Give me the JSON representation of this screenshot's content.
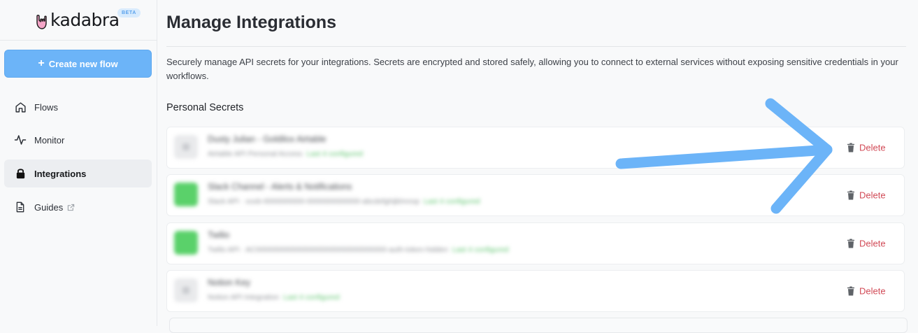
{
  "brand": {
    "name": "kadabra",
    "badge": "BETA"
  },
  "sidebar": {
    "create_button": "Create new flow",
    "items": [
      {
        "label": "Flows",
        "icon": "home-icon",
        "active": false
      },
      {
        "label": "Monitor",
        "icon": "activity-icon",
        "active": false
      },
      {
        "label": "Integrations",
        "icon": "lock-icon",
        "active": true
      },
      {
        "label": "Guides",
        "icon": "document-icon",
        "active": false,
        "external": true
      }
    ]
  },
  "main": {
    "title": "Manage Integrations",
    "description": "Securely manage API secrets for your integrations. Secrets are encrypted and stored safely, allowing you to connect to external services without exposing sensitive credentials in your workflows.",
    "section_title": "Personal Secrets",
    "secrets": [
      {
        "name": "Dusty Julian - Goldilox Airtable",
        "meta": "Airtable API Personal Access",
        "status": "Last 4 configured",
        "icon": "gray",
        "delete_label": "Delete"
      },
      {
        "name": "Slack Channel - Alerts & Notifications",
        "meta": "Slack API · xoxb-0000000000-0000000000000-abcdefghijklmnop",
        "status": "Last 4 configured",
        "icon": "green",
        "delete_label": "Delete"
      },
      {
        "name": "Twilio",
        "meta": "Twilio API · AC00000000000000000000000000000000-auth-token-hidden",
        "status": "Last 4 configured",
        "icon": "green",
        "delete_label": "Delete"
      },
      {
        "name": "Notion Key",
        "meta": "Notion API Integration",
        "status": "Last 4 configured",
        "icon": "gray",
        "delete_label": "Delete"
      }
    ]
  },
  "annotation": {
    "color": "#6cb4f8"
  }
}
